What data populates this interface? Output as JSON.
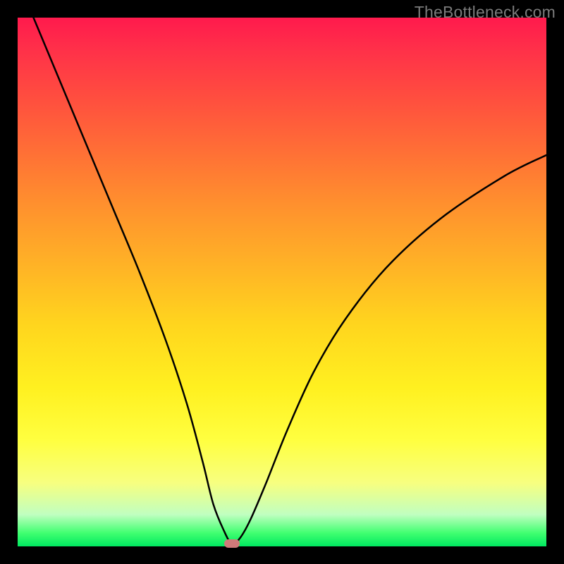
{
  "watermark": "TheBottleneck.com",
  "chart_data": {
    "type": "line",
    "title": "",
    "xlabel": "",
    "ylabel": "",
    "xlim": [
      0,
      100
    ],
    "ylim": [
      0,
      100
    ],
    "grid": false,
    "background": {
      "type": "vertical-gradient",
      "stops": [
        {
          "pos": 0,
          "color": "#ff1a4d"
        },
        {
          "pos": 50,
          "color": "#ffc020"
        },
        {
          "pos": 80,
          "color": "#ffff40"
        },
        {
          "pos": 100,
          "color": "#00e860"
        }
      ]
    },
    "series": [
      {
        "name": "bottleneck-curve",
        "x": [
          3,
          8,
          13,
          18,
          23,
          28,
          32,
          35,
          37,
          39,
          40.5,
          42,
          44,
          47,
          51,
          56,
          62,
          70,
          80,
          92,
          100
        ],
        "values": [
          100,
          88,
          76,
          64,
          52,
          39,
          27,
          16,
          8,
          3,
          0.5,
          1.5,
          5,
          12,
          22,
          33,
          43,
          53,
          62,
          70,
          74
        ],
        "color": "#000000"
      }
    ],
    "annotations": [
      {
        "type": "marker",
        "x": 40.5,
        "y": 0.5,
        "shape": "rounded-rect",
        "color": "#cf7a7a"
      }
    ]
  }
}
